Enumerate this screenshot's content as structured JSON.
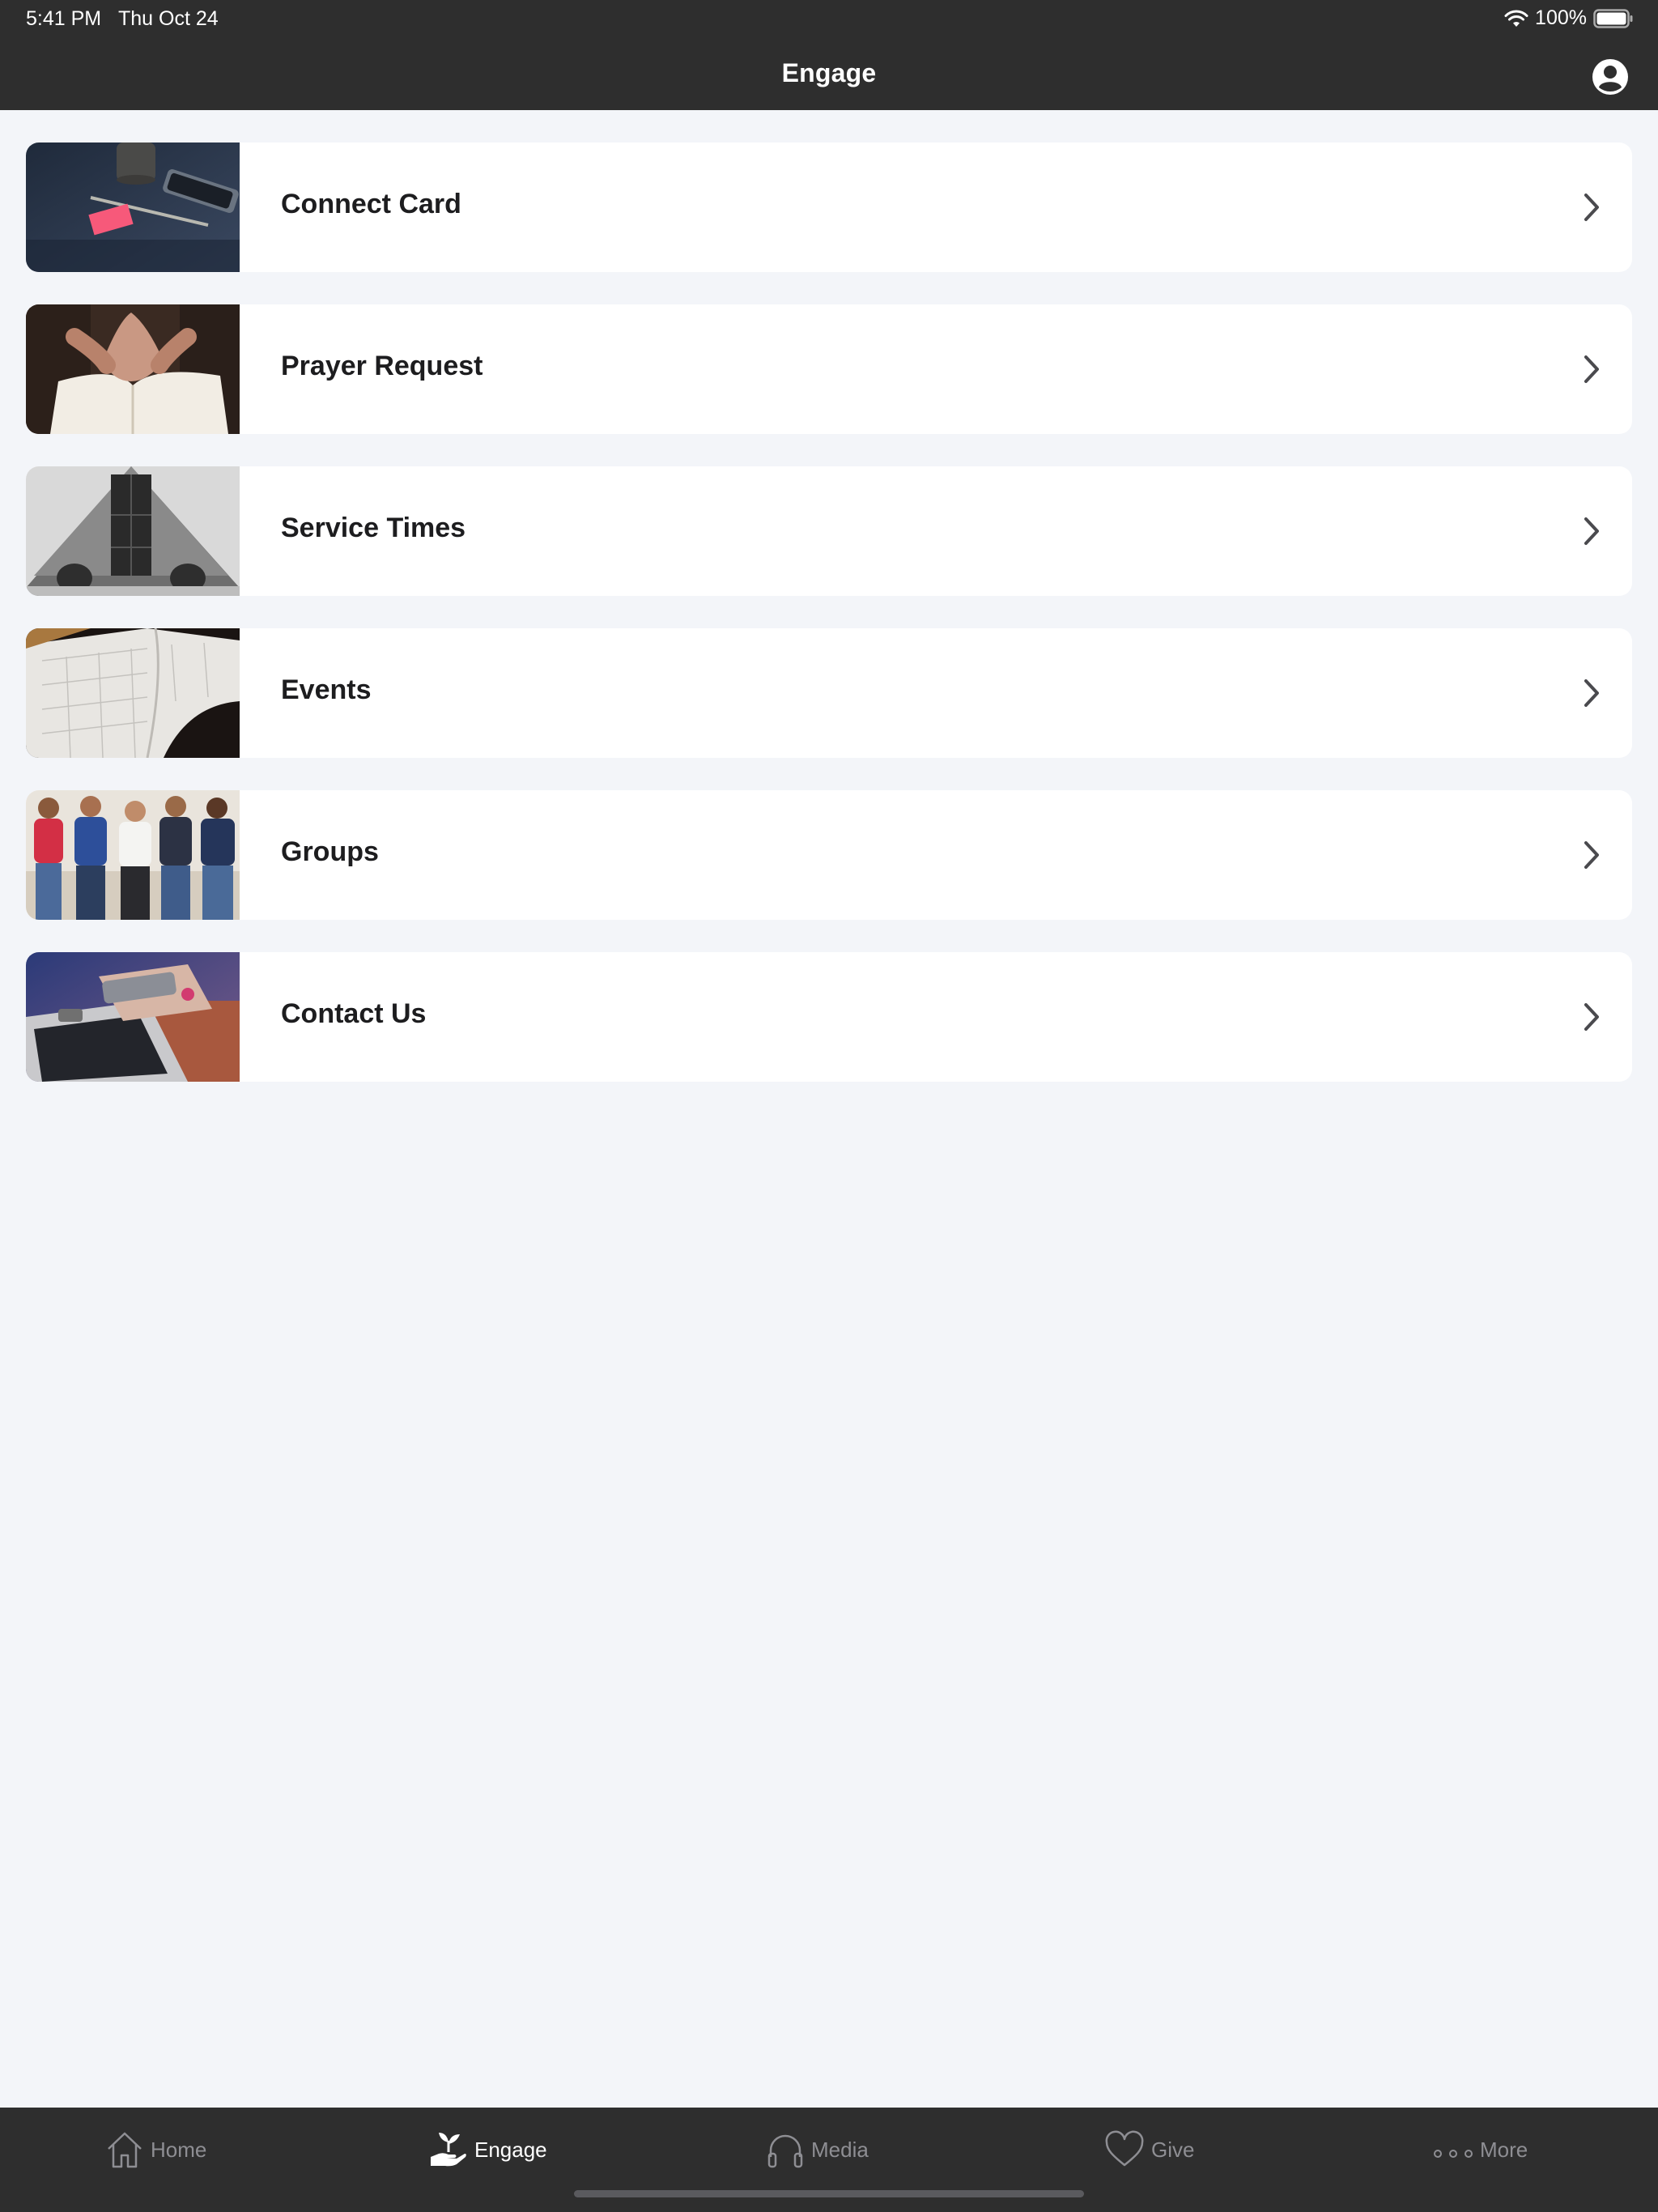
{
  "status_bar": {
    "time": "5:41 PM",
    "date": "Thu Oct 24",
    "battery": "100%"
  },
  "nav": {
    "title": "Engage"
  },
  "items": [
    {
      "label": "Connect Card",
      "image": "desk-notes-photo"
    },
    {
      "label": "Prayer Request",
      "image": "praying-hands-photo"
    },
    {
      "label": "Service Times",
      "image": "church-building-photo"
    },
    {
      "label": "Events",
      "image": "calendar-planner-photo"
    },
    {
      "label": "Groups",
      "image": "group-of-people-photo"
    },
    {
      "label": "Contact Us",
      "image": "phone-laptop-photo"
    }
  ],
  "tab_bar": {
    "tabs": [
      {
        "label": "Home",
        "icon": "house-icon",
        "active": false
      },
      {
        "label": "Engage",
        "icon": "hand-plant-icon",
        "active": true
      },
      {
        "label": "Media",
        "icon": "headphones-icon",
        "active": false
      },
      {
        "label": "Give",
        "icon": "heart-icon",
        "active": false
      },
      {
        "label": "More",
        "icon": "ellipsis-icon",
        "active": false
      }
    ]
  },
  "colors": {
    "bar_background": "#2e2e2e",
    "page_background": "#f3f5f9",
    "card_background": "#ffffff",
    "active_tab": "#ffffff",
    "inactive_tab": "#8e8e93"
  }
}
